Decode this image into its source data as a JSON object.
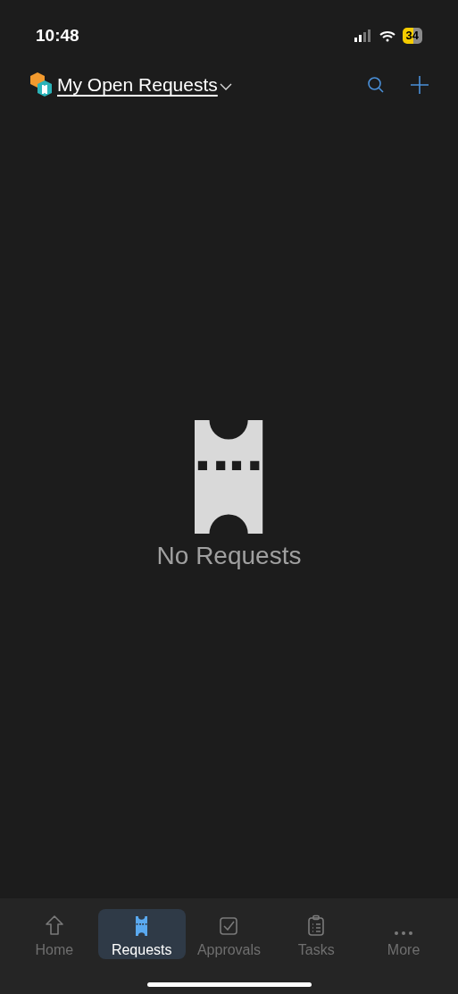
{
  "status_bar": {
    "time": "10:48",
    "battery": "34"
  },
  "header": {
    "title": "My Open Requests"
  },
  "empty_state": {
    "message": "No Requests"
  },
  "tabs": [
    {
      "label": "Home",
      "selected": false
    },
    {
      "label": "Requests",
      "selected": true
    },
    {
      "label": "Approvals",
      "selected": false
    },
    {
      "label": "Tasks",
      "selected": false
    },
    {
      "label": "More",
      "selected": false
    }
  ]
}
